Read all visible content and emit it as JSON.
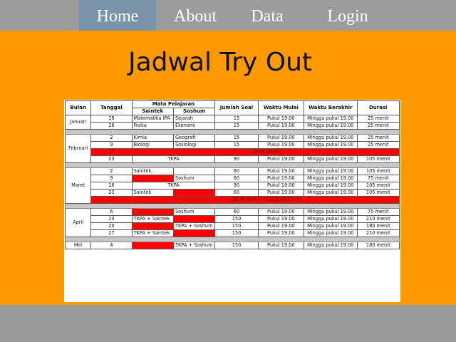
{
  "nav": {
    "home": "Home",
    "about": "About",
    "data": "Data",
    "login": "Login"
  },
  "page_title": "Jadwal Try Out",
  "table": {
    "headers": {
      "bulan": "Bulan",
      "tanggal": "Tanggal",
      "mapel": "Mata Pelajaran",
      "saintek": "Saintek",
      "soshum": "Soshum",
      "jumlah_soal": "Jumlah Soal",
      "waktu_mulai": "Waktu Mulai",
      "waktu_berakhir": "Waktu Berakhir",
      "durasi": "Durasi"
    },
    "months": {
      "januari": "Januari",
      "februari": "Februari",
      "maret": "Maret",
      "april": "April",
      "mei": "Mei"
    },
    "rows": [
      {
        "tanggal": "19",
        "saintek": "Matematika IPA",
        "soshum": "Sejarah",
        "soal": "15",
        "mulai": "Pukul 19.00",
        "berakhir": "Minggu pukul 19.00",
        "durasi": "25 menit"
      },
      {
        "tanggal": "26",
        "saintek": "Fisika",
        "soshum": "Ekonomi",
        "soal": "15",
        "mulai": "Pukul 19.00",
        "berakhir": "Minggu pukul 19.00",
        "durasi": "25 menit"
      },
      {
        "tanggal": "2",
        "saintek": "Kimia",
        "soshum": "Geografi",
        "soal": "15",
        "mulai": "Pukul 19.00",
        "berakhir": "Minggu pukul 19.00",
        "durasi": "25 menit"
      },
      {
        "tanggal": "9",
        "saintek": "Biologi",
        "soshum": "Sosiologi",
        "soal": "15",
        "mulai": "Pukul 19.00",
        "berakhir": "Minggu pukul 19.00",
        "durasi": "25 menit"
      },
      {
        "tanggal": "16",
        "note": "LIBUR IMLEK"
      },
      {
        "tanggal": "23",
        "combined": "TKPA",
        "soal": "90",
        "mulai": "Pukul 19.00",
        "berakhir": "Minggu pukul 19.00",
        "durasi": "105 menit"
      },
      {
        "tanggal": "2",
        "saintek": "Saintek",
        "soshum": "",
        "soal": "60",
        "mulai": "Pukul 19.00",
        "berakhir": "Minggu pukul 19.00",
        "durasi": "105 menit"
      },
      {
        "tanggal": "9",
        "saintek": "",
        "soshum": "Soshum",
        "soal": "60",
        "mulai": "Pukul 19.00",
        "berakhir": "Minggu pukul 19.00",
        "durasi": "75 menit"
      },
      {
        "tanggal": "16",
        "combined": "TKPA",
        "soal": "90",
        "mulai": "Pukul 19.00",
        "berakhir": "Minggu pukul 19.00",
        "durasi": "105 menit"
      },
      {
        "tanggal": "23",
        "saintek": "Saintek",
        "soshum": "",
        "soal": "60",
        "mulai": "Pukul 19.00",
        "berakhir": "Minggu pukul 19.00",
        "durasi": "105 menit"
      },
      {
        "tanggal": "30",
        "note": "LIBUR WAFAT YESUS KRISTUS"
      },
      {
        "tanggal": "6",
        "saintek": "",
        "soshum": "Soshum",
        "soal": "60",
        "mulai": "Pukul 19.00",
        "berakhir": "Minggu pukul 19.00",
        "durasi": "75 menit"
      },
      {
        "tanggal": "13",
        "saintek": "TKPA + Saintek",
        "soshum": "",
        "soal": "150",
        "mulai": "Pukul 19.00",
        "berakhir": "Minggu pukul 19.00",
        "durasi": "210 menit"
      },
      {
        "tanggal": "20",
        "saintek": "",
        "soshum": "TKPA + Soshum",
        "soal": "150",
        "mulai": "Pukul 19.00",
        "berakhir": "Minggu pukul 19.00",
        "durasi": "180 menit"
      },
      {
        "tanggal": "27",
        "saintek": "TKPA + Saintek",
        "soshum": "",
        "soal": "150",
        "mulai": "Pukul 19.00",
        "berakhir": "Minggu pukul 19.00",
        "durasi": "210 menit"
      },
      {
        "tanggal": "4",
        "saintek": "",
        "soshum": "TKPA + Soshum",
        "soal": "150",
        "mulai": "Pukul 19.00",
        "berakhir": "Minggu pukul 19.00",
        "durasi": "180 menit"
      }
    ]
  },
  "colors": {
    "nav_bg": "#9c9c9c",
    "nav_active": "#7b93a8",
    "main_bg": "#ff9900",
    "highlight_red": "#ff0000",
    "separator": "#c8c8c8"
  }
}
